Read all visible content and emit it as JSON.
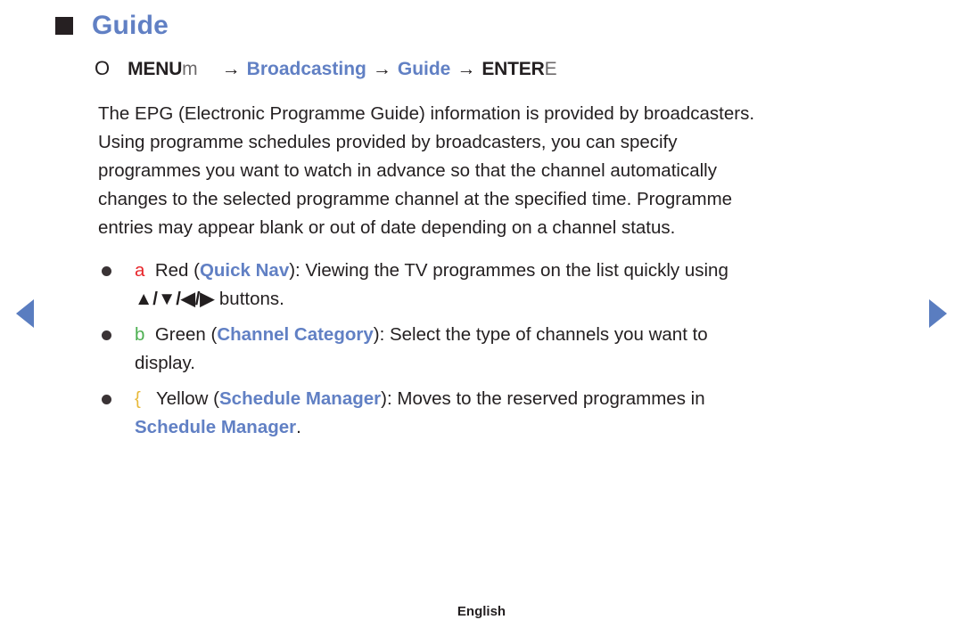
{
  "page": {
    "heading": {
      "bullet_icon": "square-bullet-icon",
      "title": "Guide"
    },
    "menu_path": {
      "circle_glyph": "O",
      "menu_label": "MENU",
      "menu_suffix": "m",
      "arrow": "→",
      "step_broadcasting": "Broadcasting",
      "step_guide": "Guide",
      "enter_label": "ENTER",
      "enter_suffix": "E"
    },
    "body_paragraph": {
      "lines": [
        "The EPG (Electronic Programme Guide) information is provided by broadcasters.",
        "Using programme schedules provided by broadcasters, you can specify",
        "programmes you want to watch in advance so that the channel automatically",
        "changes to the selected programme channel at the specified time. Programme",
        "entries may appear blank or out of date depending on a channel status."
      ]
    },
    "bullets": [
      {
        "key_glyph": "a",
        "key_color": "#e8252a",
        "colour_name": "Red",
        "open_paren": "(",
        "feature_label": "Quick Nav",
        "close_paren": "):",
        "text_after": "Viewing the TV programmes on the list quickly using",
        "second_line_keys": "▲/▼/◀/▶",
        "second_line_text": "buttons."
      },
      {
        "key_glyph": "b",
        "key_color": "#4caf50",
        "colour_name": "Green",
        "open_paren": "(",
        "feature_label": "Channel Category",
        "close_paren": "):",
        "text_after": "Select the type of channels you want to",
        "second_line_keys": "",
        "second_line_text": "display."
      },
      {
        "key_glyph": "{",
        "key_color": "#e8b93a",
        "colour_name": "Yellow",
        "open_paren": "(",
        "feature_label": "Schedule Manager",
        "close_paren": "):",
        "text_after": "Moves to the reserved programmes in",
        "second_line_keys": "",
        "second_line_text": "Schedule Manager",
        "second_line_tail": "."
      }
    ],
    "nav": {
      "prev_icon": "left-triangle-arrow-icon",
      "next_icon": "right-triangle-arrow-icon"
    },
    "footer": {
      "language": "English"
    },
    "colors": {
      "accent_blue": "#6180c4",
      "nav_blue": "#5a7dc0",
      "red": "#e8252a",
      "green": "#4caf50",
      "yellow": "#e8b93a",
      "text": "#231f20"
    }
  }
}
